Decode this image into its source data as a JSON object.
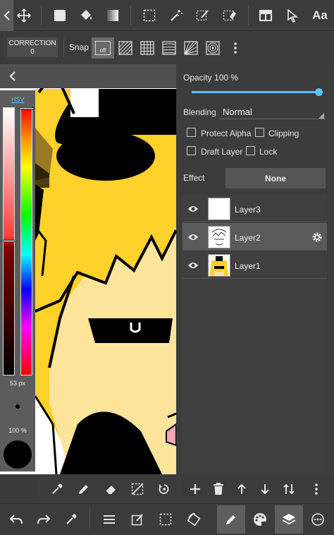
{
  "toolbar": {
    "icons": [
      "chevron-left-icon",
      "move-icon",
      "rectangle-fill-icon",
      "fill-bucket-icon",
      "gradient-icon",
      "select-rect-icon",
      "magic-wand-icon",
      "select-pen-icon",
      "select-eraser-icon",
      "layout-icon",
      "pointer-icon",
      "text-icon"
    ],
    "text_icon_label": "Aa"
  },
  "snap_bar": {
    "correction_label": "CORRECTION",
    "correction_value": "0",
    "snap_label": "Snap",
    "snap_off_label": "off"
  },
  "color_panel": {
    "mode_label": "HSV",
    "brush_size": "53 px",
    "brush_opacity": "100 %"
  },
  "layer_panel": {
    "opacity_label": "Opacity 100 %",
    "opacity_value": 1.0,
    "blending_label": "Blending",
    "blending_value": "Normal",
    "protect_alpha_label": "Protect Alpha",
    "clipping_label": "Clipping",
    "draft_layer_label": "Draft Layer",
    "lock_label": "Lock",
    "effect_label": "Effect",
    "effect_value": "None",
    "layers": [
      {
        "name": "Layer3",
        "selected": false
      },
      {
        "name": "Layer2",
        "selected": true
      },
      {
        "name": "Layer1",
        "selected": false
      }
    ]
  },
  "colors": {
    "accent": "#5bc2ff",
    "panel_bg": "#3c3c3c",
    "selected_row": "#5a5a5a",
    "canvas_yellow": "#ffd12a",
    "skin": "#fde49b"
  }
}
